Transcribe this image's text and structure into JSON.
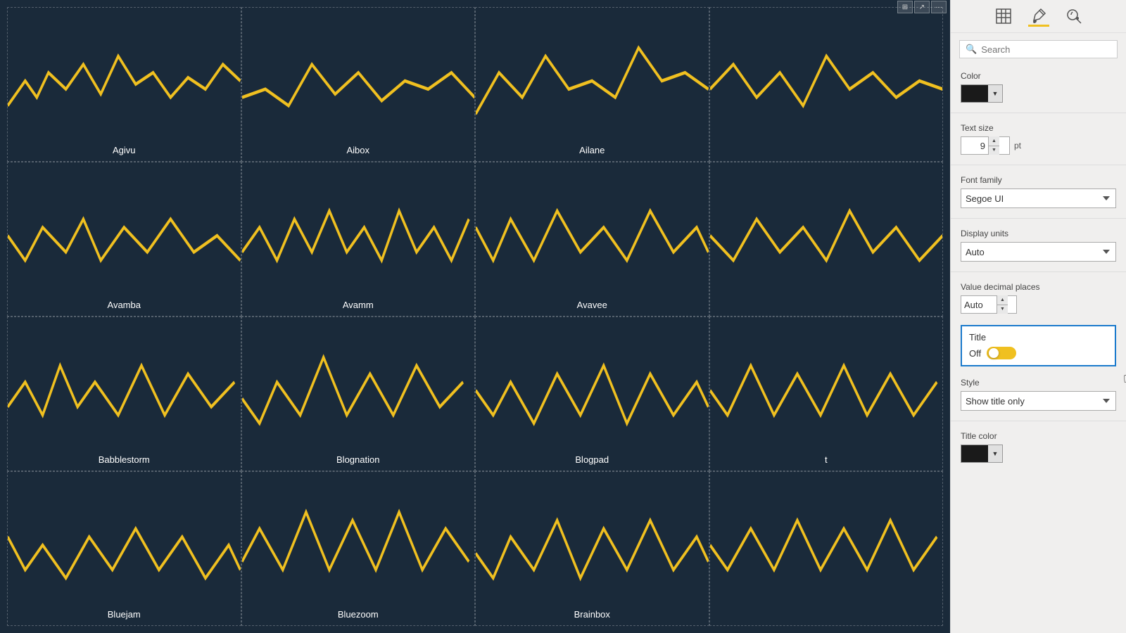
{
  "toolbar": {
    "btn1": "⊞",
    "btn2": "↗",
    "btn3": "..."
  },
  "panel": {
    "icons": [
      {
        "name": "table-icon",
        "symbol": "⊞",
        "active": false
      },
      {
        "name": "paint-icon",
        "symbol": "🖌",
        "active": true
      },
      {
        "name": "filter-icon",
        "symbol": "🔍",
        "active": false
      }
    ],
    "search_placeholder": "Search",
    "color_label": "Color",
    "text_size_label": "Text size",
    "text_size_value": "9",
    "text_size_unit": "pt",
    "font_family_label": "Font family",
    "font_family_value": "Segoe UI",
    "display_units_label": "Display units",
    "display_units_value": "Auto",
    "value_decimal_label": "Value decimal places",
    "value_decimal_value": "Auto",
    "title_label": "Title",
    "title_toggle_label": "Off",
    "style_label": "Style",
    "style_value": "Show title only",
    "title_color_label": "Title color"
  },
  "charts": [
    {
      "name": "Agivu",
      "row": 0,
      "col": 0
    },
    {
      "name": "Aibox",
      "row": 0,
      "col": 1
    },
    {
      "name": "Ailane",
      "row": 0,
      "col": 2
    },
    {
      "name": "",
      "row": 0,
      "col": 3
    },
    {
      "name": "Avamba",
      "row": 1,
      "col": 0
    },
    {
      "name": "Avamm",
      "row": 1,
      "col": 1
    },
    {
      "name": "Avavee",
      "row": 1,
      "col": 2
    },
    {
      "name": "",
      "row": 1,
      "col": 3
    },
    {
      "name": "Babblestorm",
      "row": 2,
      "col": 0
    },
    {
      "name": "Blognation",
      "row": 2,
      "col": 1
    },
    {
      "name": "Blogpad",
      "row": 2,
      "col": 2
    },
    {
      "name": "t",
      "row": 2,
      "col": 3
    },
    {
      "name": "Bluejam",
      "row": 3,
      "col": 0
    },
    {
      "name": "Bluezoom",
      "row": 3,
      "col": 1
    },
    {
      "name": "Brainbox",
      "row": 3,
      "col": 2
    },
    {
      "name": "",
      "row": 3,
      "col": 3
    }
  ]
}
